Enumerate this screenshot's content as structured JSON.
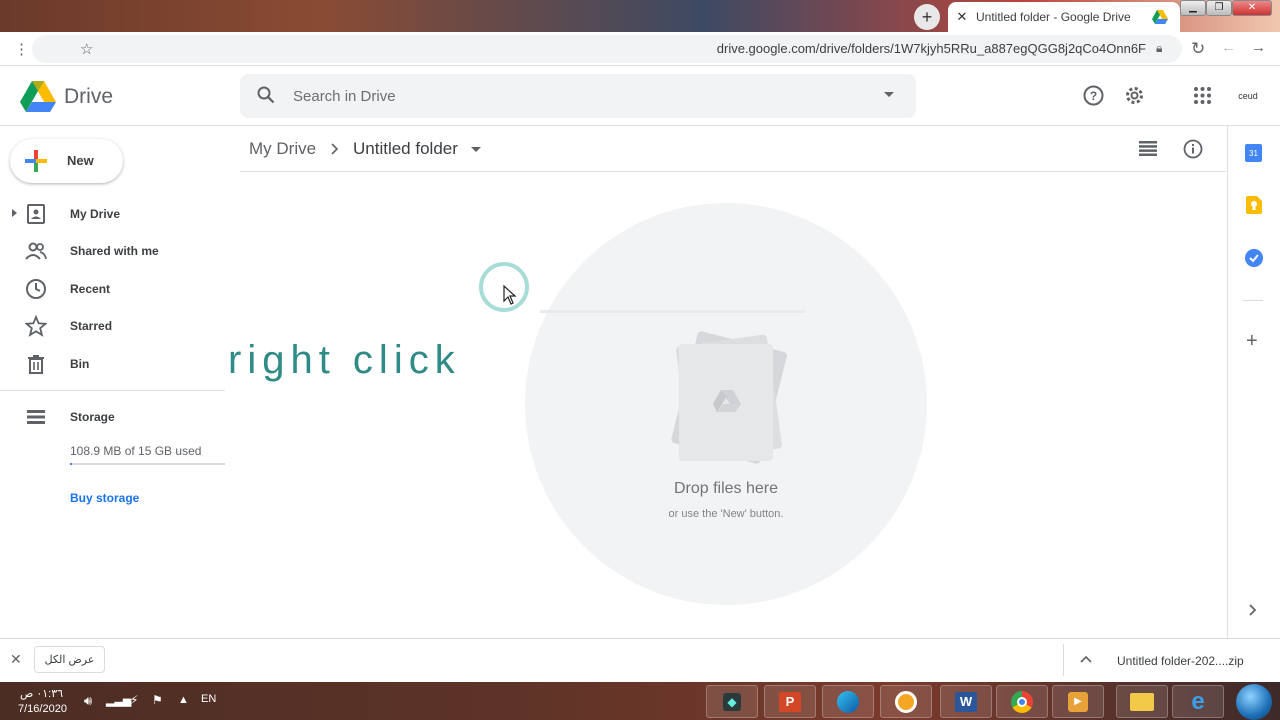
{
  "browser": {
    "tab_title": "Untitled folder - Google Drive",
    "new_tab_symbol": "+",
    "url": "drive.google.com/drive/folders/1W7kjyh5RRu_a887egQGG8j2qCo4Onn6F"
  },
  "header": {
    "app_name": "Drive",
    "search_placeholder": "Search in Drive",
    "avatar_text": "ceud"
  },
  "sidebar": {
    "new_label": "New",
    "items": [
      {
        "label": "My Drive"
      },
      {
        "label": "Shared with me"
      },
      {
        "label": "Recent"
      },
      {
        "label": "Starred"
      },
      {
        "label": "Bin"
      }
    ],
    "storage_label": "Storage",
    "storage_used": "108.9 MB of 15 GB used",
    "storage_fraction": 0.007,
    "buy_storage": "Buy storage"
  },
  "breadcrumb": {
    "root": "My Drive",
    "separator": ">",
    "current": "Untitled folder"
  },
  "empty_state": {
    "title": "Drop files here",
    "subtitle": "or use the 'New' button."
  },
  "overlay": {
    "text": "right click"
  },
  "side_panel": {
    "calendar_label": "31"
  },
  "downloads": {
    "show_all": "عرض الكل",
    "file_name": "Untitled folder-202....zip"
  },
  "taskbar": {
    "time": "٠١:٣٦ ص",
    "date": "7/16/2020",
    "lang": "EN"
  },
  "colors": {
    "accent_blue": "#1a73e8",
    "overlay_teal": "#2e8b86"
  }
}
